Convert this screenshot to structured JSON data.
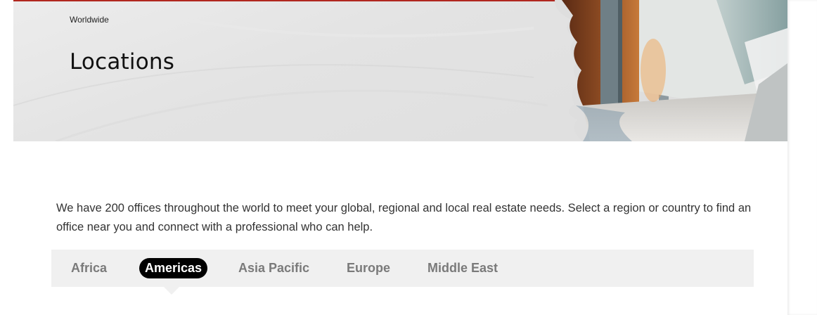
{
  "header": {
    "breadcrumb": "Worldwide",
    "title": "Locations"
  },
  "intro": {
    "text": "We have 200 offices throughout the world to meet your global, regional and local real estate needs. Select a region or country to find an office near you and connect with a professional who can help."
  },
  "regions": {
    "tabs": [
      {
        "label": "Africa"
      },
      {
        "label": "Americas"
      },
      {
        "label": "Asia Pacific"
      },
      {
        "label": "Europe"
      },
      {
        "label": "Middle East"
      }
    ],
    "selected": "Americas"
  },
  "colors": {
    "accent": "#b1271f",
    "active_tab_bg": "#000000",
    "tab_bar_bg": "#f0f0f0",
    "tab_text": "#7a7a7a"
  }
}
